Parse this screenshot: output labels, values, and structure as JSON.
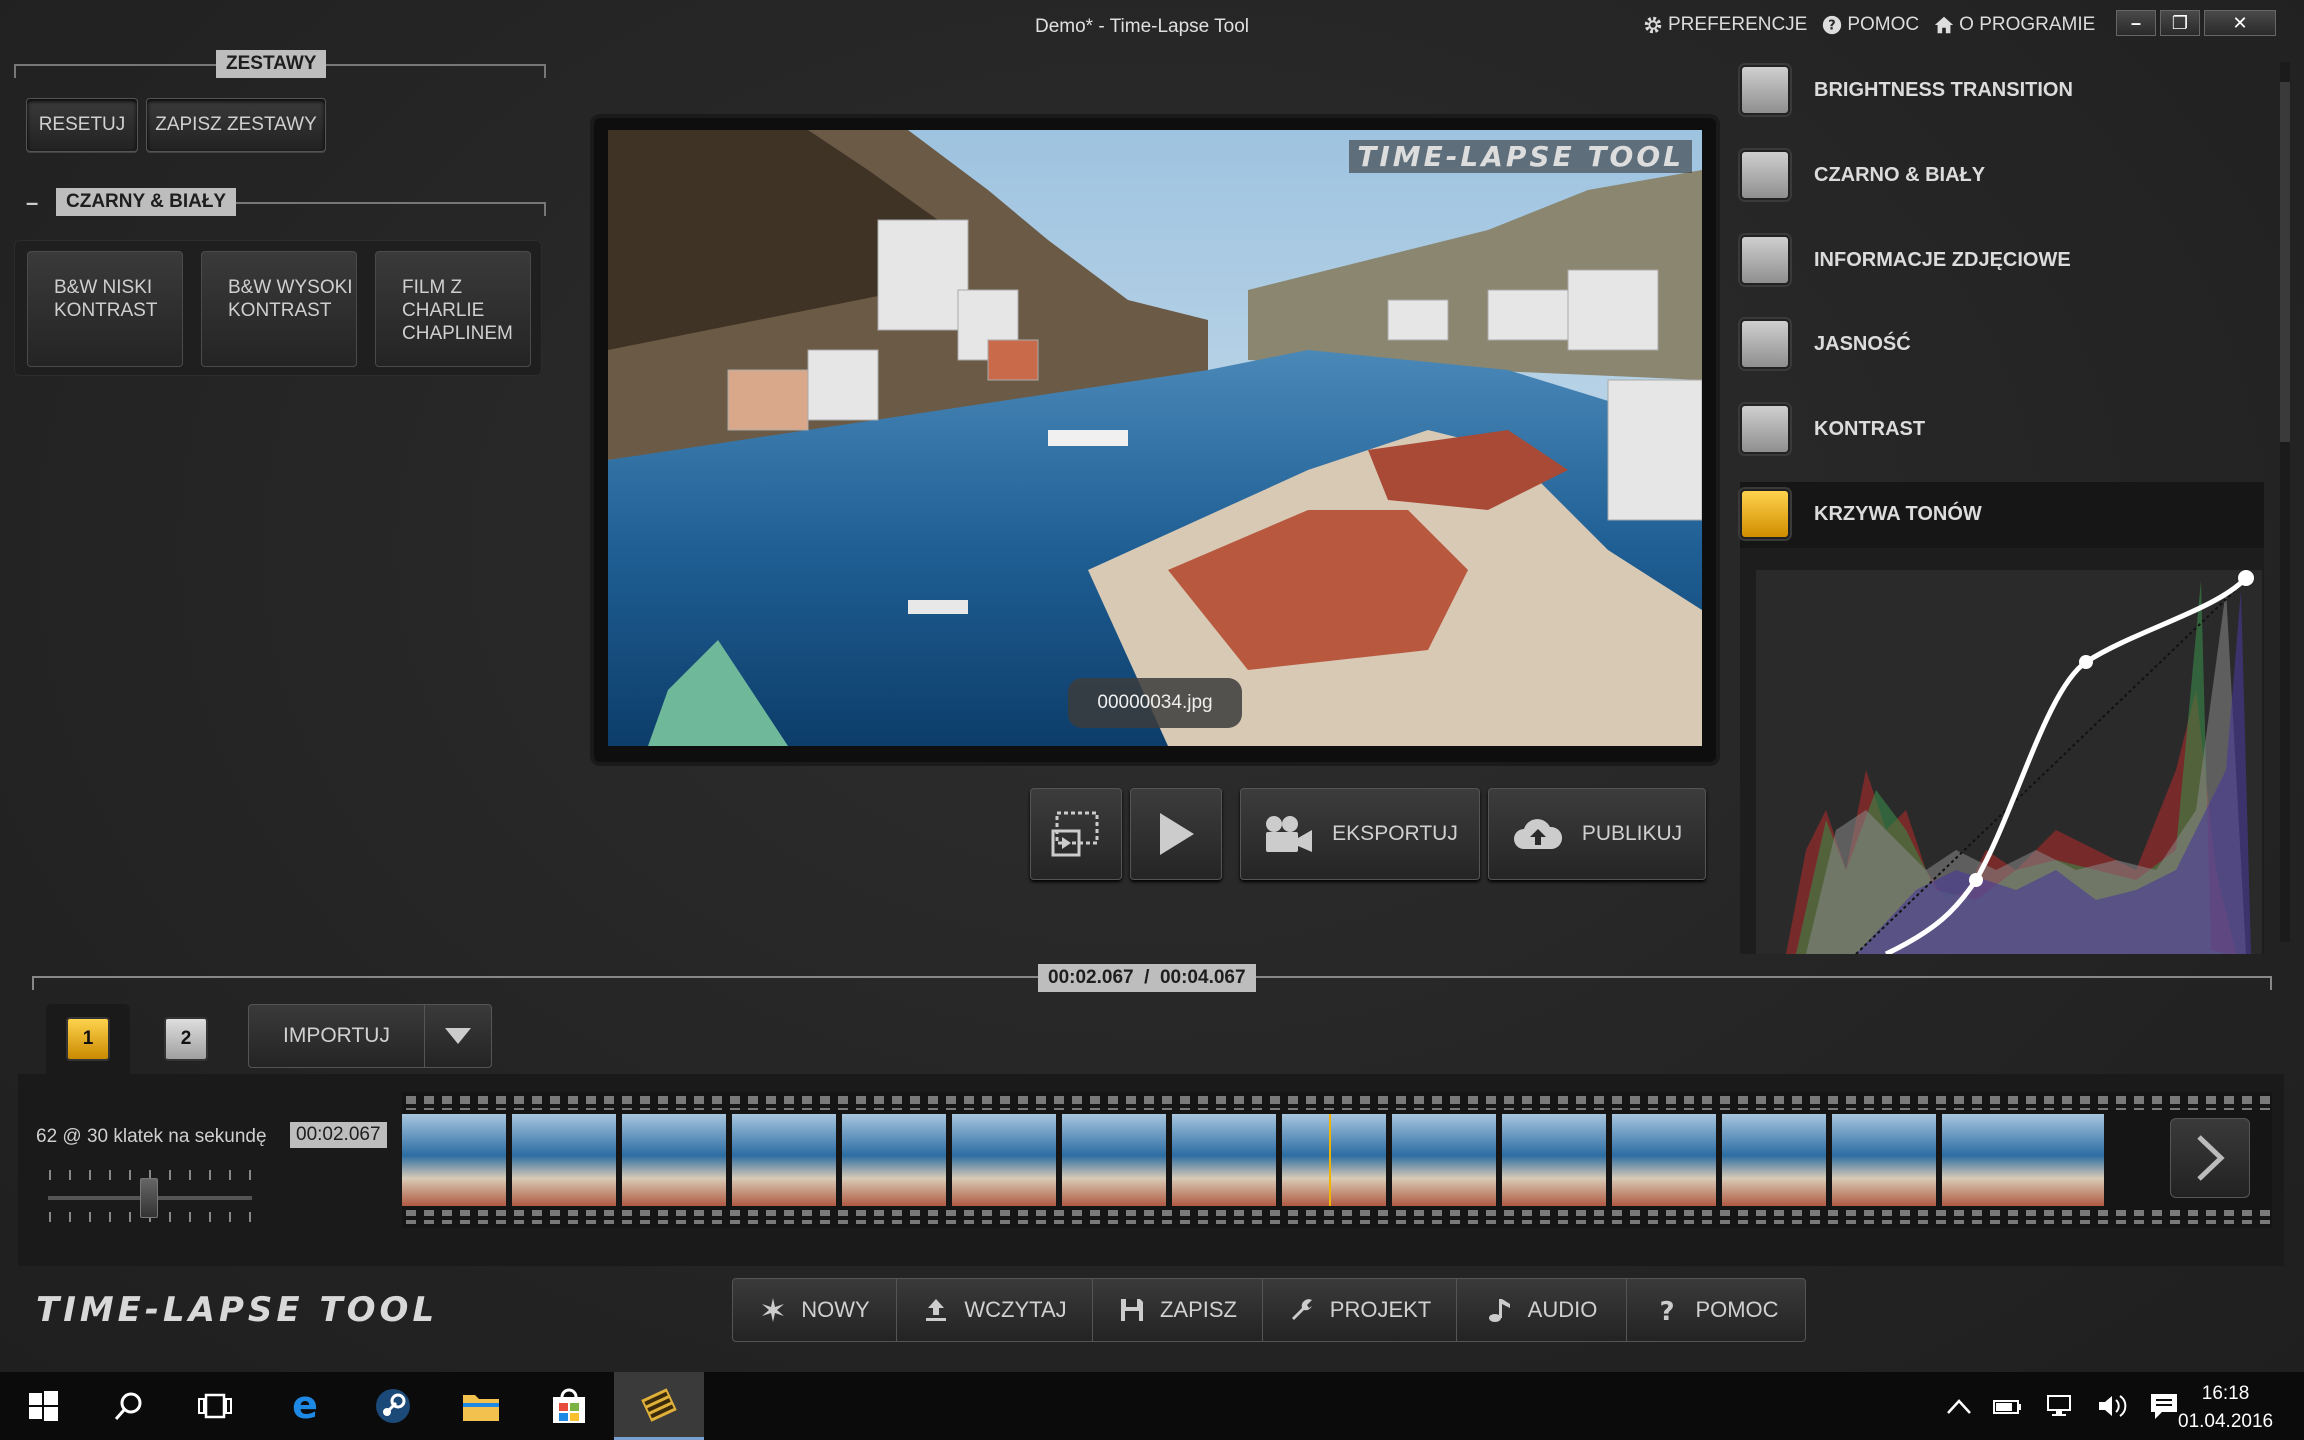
{
  "window": {
    "title": "Demo* - Time-Lapse Tool",
    "links": [
      "PREFERENCJE",
      "POMOC",
      "O PROGRAMIE"
    ],
    "minimize": "–",
    "maximize": "❐",
    "close": "✕"
  },
  "presets": {
    "header": "ZESTAWY",
    "reset_label": "RESETUJ",
    "save_label": "ZAPISZ ZESTAWY",
    "group_collapse": "–",
    "group_title": "CZARNY & BIAŁY",
    "items": [
      {
        "label": "B&W NISKI KONTRAST"
      },
      {
        "label": "B&W WYSOKI KONTRAST"
      },
      {
        "label": "FILM Z CHARLIE CHAPLINEM"
      }
    ]
  },
  "preview": {
    "watermark": "TIME-LAPSE TOOL",
    "filename": "00000034.jpg"
  },
  "controls": {
    "export_label": "EKSPORTUJ",
    "publish_label": "PUBLIKUJ"
  },
  "effects": {
    "items": [
      {
        "label": "BRIGHTNESS TRANSITION",
        "on": false
      },
      {
        "label": "CZARNO & BIAŁY",
        "on": false
      },
      {
        "label": "INFORMACJE ZDJĘCIOWE",
        "on": false
      },
      {
        "label": "JASNOŚĆ",
        "on": false
      },
      {
        "label": "KONTRAST",
        "on": false
      },
      {
        "label": "KRZYWA TONÓW",
        "on": true
      }
    ]
  },
  "timeline": {
    "time_display": "00:02.067  /  00:04.067",
    "tracks": [
      "1",
      "2"
    ],
    "import_label": "IMPORTUJ",
    "fps_text": "62 @ 30 klatek na sekundę",
    "current_time": "00:02.067"
  },
  "bottom": {
    "logo": "TIME-LAPSE TOOL",
    "items": [
      {
        "label": "NOWY",
        "icon": "star-icon"
      },
      {
        "label": "WCZYTAJ",
        "icon": "upload-icon"
      },
      {
        "label": "ZAPISZ",
        "icon": "save-icon"
      },
      {
        "label": "PROJEKT",
        "icon": "wrench-icon"
      },
      {
        "label": "AUDIO",
        "icon": "music-note-icon"
      },
      {
        "label": "POMOC",
        "icon": "question-icon"
      }
    ]
  },
  "taskbar": {
    "time": "16:18",
    "date": "01.04.2016"
  }
}
